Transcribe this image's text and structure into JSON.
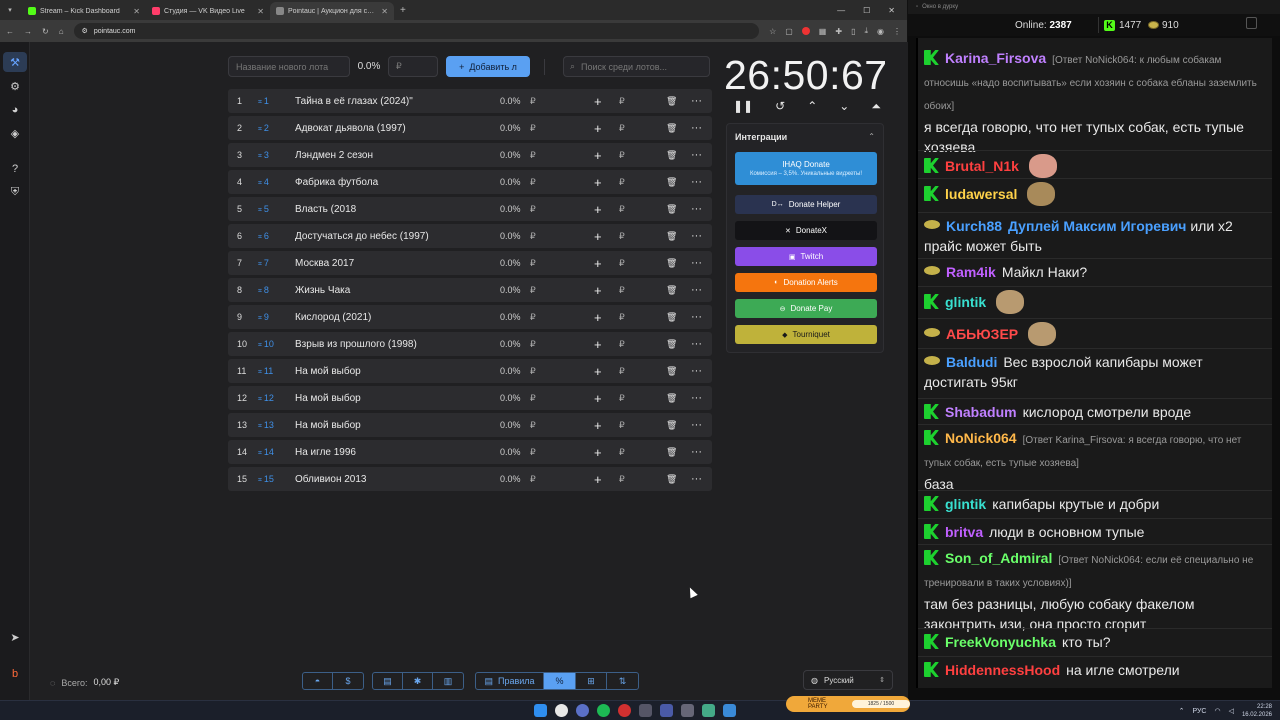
{
  "browser": {
    "tabs": [
      {
        "title": "Stream – Kick Dashboard",
        "color": "#53fc18",
        "active": false
      },
      {
        "title": "Студия — VK Видео Live",
        "color": "#ff3d6a",
        "active": false
      },
      {
        "title": "Pointauc | Аукцион для стрим…",
        "color": "#888888",
        "active": true
      }
    ],
    "url": "pointauc.com"
  },
  "toolbar": {
    "lot_placeholder": "Название нового лота",
    "percent": "0.0%",
    "amount_placeholder": "₽",
    "add_label": "Добавить л",
    "search_placeholder": "Поиск среди лотов..."
  },
  "lots": [
    {
      "num": "1",
      "id": "1",
      "name": "Тайна в её глазах (2024)\"",
      "pct": "0.0%"
    },
    {
      "num": "2",
      "id": "2",
      "name": "Адвокат дьявола (1997)",
      "pct": "0.0%"
    },
    {
      "num": "3",
      "id": "3",
      "name": "Лэндмен 2 сезон",
      "pct": "0.0%"
    },
    {
      "num": "4",
      "id": "4",
      "name": "Фабрика футбола",
      "pct": "0.0%"
    },
    {
      "num": "5",
      "id": "5",
      "name": "Власть (2018",
      "pct": "0.0%"
    },
    {
      "num": "6",
      "id": "6",
      "name": "Достучаться до небес (1997)",
      "pct": "0.0%"
    },
    {
      "num": "7",
      "id": "7",
      "name": "Москва 2017",
      "pct": "0.0%"
    },
    {
      "num": "8",
      "id": "8",
      "name": "Жизнь Чака",
      "pct": "0.0%"
    },
    {
      "num": "9",
      "id": "9",
      "name": "Кислород (2021)",
      "pct": "0.0%"
    },
    {
      "num": "10",
      "id": "10",
      "name": "Взрыв из прошлого (1998)",
      "pct": "0.0%"
    },
    {
      "num": "11",
      "id": "11",
      "name": "На мой выбор",
      "pct": "0.0%"
    },
    {
      "num": "12",
      "id": "12",
      "name": "На мой выбор",
      "pct": "0.0%"
    },
    {
      "num": "13",
      "id": "13",
      "name": "На мой выбор",
      "pct": "0.0%"
    },
    {
      "num": "14",
      "id": "14",
      "name": "На игле 1996",
      "pct": "0.0%"
    },
    {
      "num": "15",
      "id": "15",
      "name": "Обливион 2013",
      "pct": "0.0%"
    }
  ],
  "currency": "₽",
  "timer": {
    "display": "26:50:67"
  },
  "integrations": {
    "title": "Интеграции",
    "ihaq": {
      "label": "IHAQ Donate",
      "sub": "Комиссия – 3,5%. Уникальные виджеты!"
    },
    "buttons": [
      {
        "label": "Donate Helper",
        "color": "#2a3350"
      },
      {
        "label": "DonateX",
        "color": "#131316"
      },
      {
        "label": "Twitch",
        "color": "#8a4de8"
      },
      {
        "label": "Donation Alerts",
        "color": "#f5750e"
      },
      {
        "label": "Donate Pay",
        "color": "#3daa55"
      },
      {
        "label": "Tourniquet",
        "color": "#bfb23a"
      }
    ]
  },
  "footer": {
    "total_label": "Всего:",
    "total_value": "0,00 ₽",
    "rules_label": "Правила",
    "percent_symbol": "%",
    "language": "Русский"
  },
  "chat": {
    "window_title": "Окно в дурку",
    "online_label": "Online:",
    "online_count": "2387",
    "kick_count": "1477",
    "points_count": "910",
    "messages": [
      {
        "nick": "Karina_Firsova",
        "color": "#c080ff",
        "badge": "kick",
        "reply": "[Ответ NoNick064: к любым собакам относишь «надо воспитывать» если хозяин с собака ебланы заземлить обоих]",
        "text": "я всегда говорю, что нет тупых собак, есть тупые хозяева"
      },
      {
        "nick": "Brutal_N1k",
        "color": "#ff4040",
        "badge": "kick",
        "text": "",
        "emote": "#d99a8a"
      },
      {
        "nick": "ludawersal",
        "color": "#ffd24a",
        "badge": "kick",
        "text": "",
        "emote": "#a88a5a"
      },
      {
        "nick": "Kurch88",
        "color": "#4aa0ff",
        "badge": "pea",
        "text": "Дуплей Максим Игоревич или x2 прайс может быть",
        "mention": true
      },
      {
        "nick": "Ram4ik",
        "color": "#c060ff",
        "badge": "pea",
        "text": "Майкл Наки?"
      },
      {
        "nick": "glintik",
        "color": "#38e0d0",
        "badge": "kick",
        "text": "",
        "emote": "#b89a70"
      },
      {
        "nick": "АБЬЮЗЕР",
        "color": "#ff4a4a",
        "badge": "pea",
        "text": "",
        "emote": "#b89a70"
      },
      {
        "nick": "Baldudi",
        "color": "#4aa0ff",
        "badge": "pea",
        "text": "Вес взрослой капибары может достигать 95кг"
      },
      {
        "nick": "Shabadum",
        "color": "#c080ff",
        "badge": "kick",
        "text": "кислород смотрели вроде"
      },
      {
        "nick": "NoNick064",
        "color": "#ffb84a",
        "badge": "kick",
        "reply": "[Ответ Karina_Firsova: я всегда говорю, что нет тупых собак, есть тупые хозяева]",
        "text": "база"
      },
      {
        "nick": "glintik",
        "color": "#38e0d0",
        "badge": "kick",
        "text": "капибары крутые и добри"
      },
      {
        "nick": "britva",
        "color": "#c060ff",
        "badge": "kick",
        "text": "люди в основном тупые"
      },
      {
        "nick": "Son_of_Admiral",
        "color": "#6aff6a",
        "badge": "kick",
        "reply": "[Ответ NoNick064: если её специально не тренировали в таких условиях)]",
        "text": "там без разницы, любую собаку факелом законтрить изи, она просто сгорит"
      },
      {
        "nick": "FreekVonyuchka",
        "color": "#6aff6a",
        "badge": "kick",
        "text": "кто ты?"
      },
      {
        "nick": "HiddennessHood",
        "color": "#ff4040",
        "badge": "kick",
        "text": "на игле смотрели"
      }
    ]
  },
  "taskbar": {
    "lang": "РУС",
    "time": "22:28",
    "date": "16.02.2026",
    "meme_title": "MEME PARTY",
    "meme_progress": "1825 / 1500"
  },
  "mention": "Дуплей Максим Игоревич"
}
